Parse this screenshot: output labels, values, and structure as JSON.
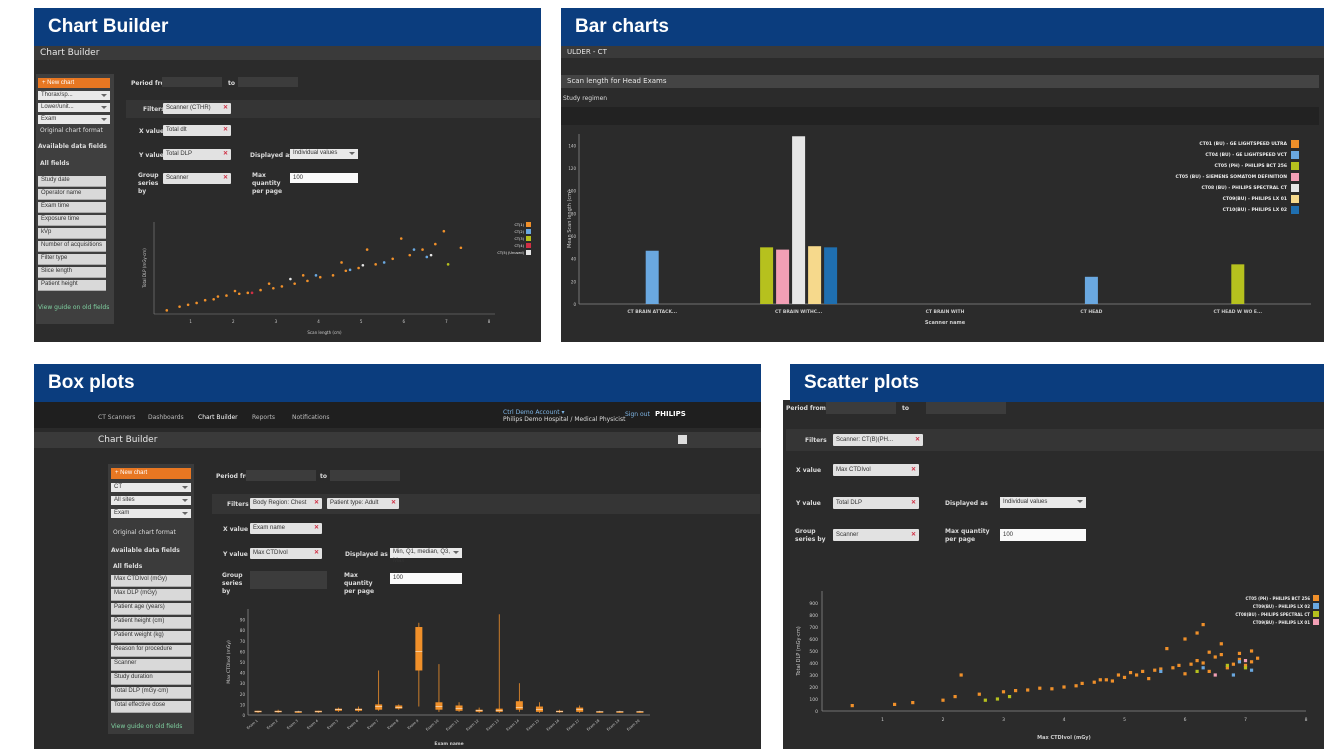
{
  "panels": {
    "chart_builder": {
      "band_title": "Chart Builder",
      "window_title": "Chart Builder",
      "side_button": "+ New chart",
      "side_selects": [
        "Thorax/sp...",
        "Lower/unit...",
        "Exam"
      ],
      "radio_label": "Original chart format",
      "available_label": "Available data fields",
      "list_header": "All fields",
      "list_items": [
        "Study date",
        "Operator name",
        "Exam time",
        "Exposure time",
        "kVp",
        "Number of acquisitions",
        "Filter type",
        "Slice length",
        "Patient height"
      ],
      "green_link": "View guide on old fields",
      "period_label": "Period from",
      "to_label": "to",
      "filters_label": "Filters",
      "filter_chip": "Scanner (CTHR)",
      "x_label": "X value",
      "x_chip": "Total dlt",
      "y_label": "Y value",
      "y_chip": "Total DLP",
      "displayed_as_label": "Displayed as",
      "displayed_as_value": "Individual values",
      "group_label": "Group series by",
      "group_chip": "Scanner",
      "maxq_label": "Max quantity per page",
      "maxq_value": "100",
      "y_axis_label": "Total DLP (mGy·cm)",
      "x_axis_label": "Scan length (cm)",
      "legend": [
        "CT(1)",
        "CT(2)",
        "CT(3)",
        "CT(4)",
        "CT(5) (Unused)"
      ]
    },
    "bar_charts": {
      "band_title": "Bar charts",
      "header_text": "ULDER - CT",
      "chart_title": "Scan length for Head Exams",
      "subheader": "Study regimen",
      "y_axis_label": "Mean Scan length (cm)",
      "x_axis_label": "Scanner name"
    },
    "box_plots": {
      "band_title": "Box plots",
      "nav": [
        "CT Scanners",
        "Dashboards",
        "Chart Builder",
        "Reports",
        "Notifications"
      ],
      "user_text": "Ctrl Demo Account ▾",
      "hospital_text": "Philips Demo Hospital / Medical Physicist",
      "signout": "Sign out",
      "brand": "PHILIPS",
      "window_title": "Chart Builder",
      "side_button": "+ New chart",
      "side_selects": [
        "CT",
        "All sites",
        "Exam"
      ],
      "radio_label": "Original chart format",
      "available_label": "Available data fields",
      "list_header": "All fields",
      "list_items": [
        "Max CTDIvol (mGy)",
        "Max DLP (mGy)",
        "Patient age (years)",
        "Patient height (cm)",
        "Patient weight (kg)",
        "Reason for procedure",
        "Scanner",
        "Study duration",
        "Total DLP (mGy·cm)",
        "Total effective dose"
      ],
      "green_link": "View guide on old fields",
      "period_label": "Period from",
      "to_label": "to",
      "filters_label": "Filters",
      "filter_chip1": "Body Region: Chest",
      "filter_chip2": "Patient type: Adult",
      "x_label": "X value",
      "x_chip": "Exam name",
      "y_label": "Y value",
      "y_chip": "Max CTDIvol",
      "displayed_as_label": "Displayed as",
      "displayed_as_value": "Min, Q1, median, Q3, Max",
      "group_label": "Group series by",
      "maxq_label": "Max quantity per page",
      "maxq_value": "100",
      "y_axis_label": "Max CTDIvol (mGy)",
      "x_axis_label": "Exam name"
    },
    "scatter_plots": {
      "band_title": "Scatter plots",
      "period_label": "Period from",
      "to_label": "to",
      "filters_label": "Filters",
      "filter_chip": "Scanner: CT(B)(PH...",
      "x_label": "X value",
      "x_chip": "Max CTDIvol",
      "y_label": "Y value",
      "y_chip": "Total DLP",
      "displayed_as_label": "Displayed as",
      "displayed_as_value": "Individual values",
      "group_label": "Group series by",
      "group_chip": "Scanner",
      "maxq_label": "Max quantity per page",
      "maxq_value": "100",
      "y_axis_label": "Total DLP (mGy·cm)",
      "x_axis_label": "Max CTDIvol (mGy)"
    }
  },
  "chart_data": [
    {
      "type": "bar",
      "title": "Scan length for Head Exams",
      "xlabel": "Scanner name",
      "ylabel": "Mean Scan length (cm)",
      "ylim": [
        0,
        150
      ],
      "y_ticks": [
        0,
        20,
        40,
        60,
        80,
        100,
        120,
        140
      ],
      "categories": [
        "CT BRAIN ATTACK...",
        "CT BRAIN WITHC...",
        "CT BRAIN WITH",
        "CT HEAD",
        "CT HEAD W WO E..."
      ],
      "series": [
        {
          "name": "CT01 (BU) - GE LIGHTSPEED ULTRA",
          "color": "#f0902a",
          "values": [
            null,
            null,
            null,
            null,
            null
          ]
        },
        {
          "name": "CT04 (BU) - GE LIGHTSPEED VCT",
          "color": "#6aa8e0",
          "values": [
            47,
            null,
            null,
            24,
            null
          ]
        },
        {
          "name": "CT05 (PH) - PHILIPS BCT 256",
          "color": "#b6c11e",
          "values": [
            null,
            50,
            null,
            null,
            35
          ]
        },
        {
          "name": "CT05 (BU) - SIEMENS SOMATOM DEFINITION",
          "color": "#f29fb5",
          "values": [
            null,
            48,
            null,
            null,
            null
          ]
        },
        {
          "name": "CT08 (BU) - PHILIPS SPECTRAL CT",
          "color": "#e6e6e6",
          "values": [
            null,
            148,
            null,
            null,
            null
          ]
        },
        {
          "name": "CT09(BU) - PHILIPS LX 01",
          "color": "#f6d98c",
          "values": [
            null,
            51,
            null,
            null,
            null
          ]
        },
        {
          "name": "CT10(BU) - PHILIPS LX 02",
          "color": "#1f6fb0",
          "values": [
            null,
            50,
            null,
            null,
            null
          ]
        }
      ],
      "legend_position": "top-right"
    },
    {
      "type": "box",
      "xlabel": "Exam name",
      "ylabel": "Max CTDIvol (mGy)",
      "ylim": [
        0,
        100
      ],
      "y_ticks": [
        0,
        10,
        20,
        30,
        40,
        50,
        60,
        70,
        80,
        90
      ],
      "categories": [
        "Exam 1",
        "Exam 2",
        "Exam 3",
        "Exam 4",
        "Exam 5",
        "Exam 6",
        "Exam 7",
        "Exam 8",
        "Exam 9",
        "Exam 10",
        "Exam 11",
        "Exam 12",
        "Exam 13",
        "Exam 14",
        "Exam 15",
        "Exam 16",
        "Exam 17",
        "Exam 18",
        "Exam 19",
        "Exam 20"
      ],
      "boxes": [
        {
          "category": "Exam 1",
          "min": 2,
          "q1": 3,
          "median": 3.5,
          "q3": 4,
          "max": 4
        },
        {
          "category": "Exam 2",
          "min": 2,
          "q1": 3,
          "median": 3.5,
          "q3": 4,
          "max": 5
        },
        {
          "category": "Exam 3",
          "min": 2,
          "q1": 2.5,
          "median": 3,
          "q3": 3.5,
          "max": 4
        },
        {
          "category": "Exam 4",
          "min": 2,
          "q1": 3,
          "median": 3,
          "q3": 4,
          "max": 4
        },
        {
          "category": "Exam 5",
          "min": 3,
          "q1": 4,
          "median": 5,
          "q3": 6,
          "max": 7
        },
        {
          "category": "Exam 6",
          "min": 3,
          "q1": 4,
          "median": 5,
          "q3": 6,
          "max": 8
        },
        {
          "category": "Exam 7",
          "min": 4,
          "q1": 5,
          "median": 8,
          "q3": 10,
          "max": 42
        },
        {
          "category": "Exam 8",
          "min": 5,
          "q1": 6,
          "median": 7,
          "q3": 9,
          "max": 10
        },
        {
          "category": "Exam 9",
          "min": 8,
          "q1": 42,
          "median": 60,
          "q3": 83,
          "max": 87
        },
        {
          "category": "Exam 10",
          "min": 3,
          "q1": 5,
          "median": 8,
          "q3": 12,
          "max": 48
        },
        {
          "category": "Exam 11",
          "min": 3,
          "q1": 4,
          "median": 6,
          "q3": 9,
          "max": 12
        },
        {
          "category": "Exam 12",
          "min": 2,
          "q1": 3,
          "median": 4,
          "q3": 5,
          "max": 7
        },
        {
          "category": "Exam 13",
          "min": 2,
          "q1": 3,
          "median": 4,
          "q3": 6,
          "max": 95
        },
        {
          "category": "Exam 14",
          "min": 3,
          "q1": 5,
          "median": 7,
          "q3": 13,
          "max": 30
        },
        {
          "category": "Exam 15",
          "min": 2,
          "q1": 3,
          "median": 5,
          "q3": 8,
          "max": 12
        },
        {
          "category": "Exam 16",
          "min": 2,
          "q1": 3,
          "median": 3.5,
          "q3": 4,
          "max": 5
        },
        {
          "category": "Exam 17",
          "min": 2,
          "q1": 3,
          "median": 5,
          "q3": 7,
          "max": 9
        },
        {
          "category": "Exam 18",
          "min": 2,
          "q1": 2.5,
          "median": 3,
          "q3": 3.5,
          "max": 4
        },
        {
          "category": "Exam 19",
          "min": 2,
          "q1": 2.5,
          "median": 3,
          "q3": 3.5,
          "max": 4
        },
        {
          "category": "Exam 20",
          "min": 2,
          "q1": 2.5,
          "median": 3,
          "q3": 3.5,
          "max": 4
        }
      ],
      "color": "#f0902a"
    },
    {
      "type": "scatter",
      "xlabel": "Max CTDIvol (mGy)",
      "ylabel": "Total DLP (mGy·cm)",
      "xlim": [
        0,
        8
      ],
      "ylim": [
        0,
        1000
      ],
      "y_ticks": [
        0,
        100,
        200,
        300,
        400,
        500,
        600,
        700,
        800,
        900
      ],
      "series": [
        {
          "name": "CT05 (PH) - PHILIPS BCT 256",
          "color": "#f0902a",
          "points": [
            [
              0.5,
              45
            ],
            [
              1.2,
              55
            ],
            [
              1.5,
              70
            ],
            [
              2.0,
              90
            ],
            [
              2.2,
              120
            ],
            [
              2.3,
              300
            ],
            [
              2.6,
              140
            ],
            [
              3.0,
              160
            ],
            [
              3.2,
              170
            ],
            [
              3.4,
              175
            ],
            [
              3.6,
              190
            ],
            [
              3.8,
              185
            ],
            [
              4.0,
              200
            ],
            [
              4.2,
              210
            ],
            [
              4.3,
              230
            ],
            [
              4.5,
              240
            ],
            [
              4.6,
              260
            ],
            [
              4.8,
              250
            ],
            [
              4.9,
              300
            ],
            [
              5.0,
              280
            ],
            [
              5.1,
              320
            ],
            [
              5.3,
              330
            ],
            [
              5.4,
              270
            ],
            [
              5.5,
              340
            ],
            [
              5.6,
              350
            ],
            [
              5.8,
              360
            ],
            [
              5.9,
              380
            ],
            [
              6.0,
              310
            ],
            [
              6.1,
              390
            ],
            [
              6.2,
              420
            ],
            [
              6.3,
              400
            ],
            [
              6.4,
              330
            ],
            [
              6.5,
              450
            ],
            [
              6.6,
              470
            ],
            [
              6.7,
              360
            ],
            [
              6.8,
              390
            ],
            [
              6.9,
              430
            ],
            [
              7.0,
              380
            ],
            [
              7.1,
              410
            ],
            [
              7.2,
              440
            ],
            [
              6.2,
              650
            ],
            [
              6.0,
              600
            ],
            [
              6.3,
              720
            ],
            [
              6.6,
              560
            ],
            [
              5.7,
              520
            ],
            [
              6.9,
              480
            ],
            [
              7.1,
              500
            ],
            [
              6.4,
              490
            ],
            [
              5.2,
              300
            ],
            [
              4.7,
              260
            ]
          ]
        },
        {
          "name": "CT09(BU) - PHILIPS LX 02",
          "color": "#6aa8e0",
          "points": [
            [
              5.6,
              330
            ],
            [
              6.3,
              360
            ],
            [
              6.8,
              300
            ],
            [
              6.9,
              410
            ],
            [
              7.1,
              340
            ]
          ]
        },
        {
          "name": "CT08(BU) - PHILIPS SPECTRAL CT",
          "color": "#b6c11e",
          "points": [
            [
              2.7,
              90
            ],
            [
              2.9,
              100
            ],
            [
              3.1,
              120
            ],
            [
              6.2,
              330
            ],
            [
              6.7,
              380
            ],
            [
              7.0,
              360
            ]
          ]
        },
        {
          "name": "CT09(BU) - PHILIPS LX 01",
          "color": "#f29fb5",
          "points": [
            [
              6.5,
              300
            ],
            [
              7.0,
              420
            ]
          ]
        }
      ],
      "legend_position": "top-right"
    },
    {
      "type": "scatter",
      "xlabel": "Scan length (cm)",
      "ylabel": "Total DLP (mGy·cm)",
      "xlim": [
        0,
        8
      ],
      "ylim": [
        0,
        1000
      ],
      "series": [
        {
          "name": "CT(1)",
          "color": "#f0902a",
          "points": [
            [
              0.3,
              40
            ],
            [
              0.6,
              80
            ],
            [
              0.8,
              100
            ],
            [
              1.0,
              120
            ],
            [
              1.2,
              150
            ],
            [
              1.4,
              160
            ],
            [
              1.5,
              190
            ],
            [
              1.7,
              200
            ],
            [
              2.0,
              220
            ],
            [
              2.2,
              230
            ],
            [
              2.5,
              260
            ],
            [
              2.8,
              280
            ],
            [
              3.0,
              300
            ],
            [
              3.3,
              330
            ],
            [
              3.6,
              360
            ],
            [
              3.9,
              400
            ],
            [
              4.2,
              420
            ],
            [
              4.5,
              470
            ],
            [
              4.8,
              500
            ],
            [
              5.2,
              540
            ],
            [
              5.6,
              600
            ],
            [
              6.0,
              640
            ],
            [
              6.3,
              700
            ],
            [
              6.6,
              760
            ],
            [
              5.0,
              700
            ],
            [
              4.4,
              560
            ],
            [
              3.5,
              420
            ],
            [
              2.7,
              330
            ],
            [
              1.9,
              250
            ],
            [
              5.8,
              820
            ],
            [
              6.8,
              900
            ],
            [
              7.2,
              720
            ]
          ]
        },
        {
          "name": "CT(2)",
          "color": "#6aa8e0",
          "points": [
            [
              3.8,
              420
            ],
            [
              4.6,
              480
            ],
            [
              5.4,
              560
            ],
            [
              6.1,
              700
            ],
            [
              6.4,
              620
            ]
          ]
        },
        {
          "name": "CT(3)",
          "color": "#b6c11e",
          "points": [
            [
              6.9,
              540
            ]
          ]
        },
        {
          "name": "CT(4)",
          "color": "#d03045",
          "points": [
            [
              2.3,
              230
            ]
          ]
        },
        {
          "name": "CT(5) (Unused)",
          "color": "#e6e6e6",
          "points": [
            [
              6.5,
              640
            ],
            [
              4.9,
              530
            ],
            [
              3.2,
              380
            ]
          ]
        }
      ],
      "legend_position": "top-right"
    }
  ]
}
